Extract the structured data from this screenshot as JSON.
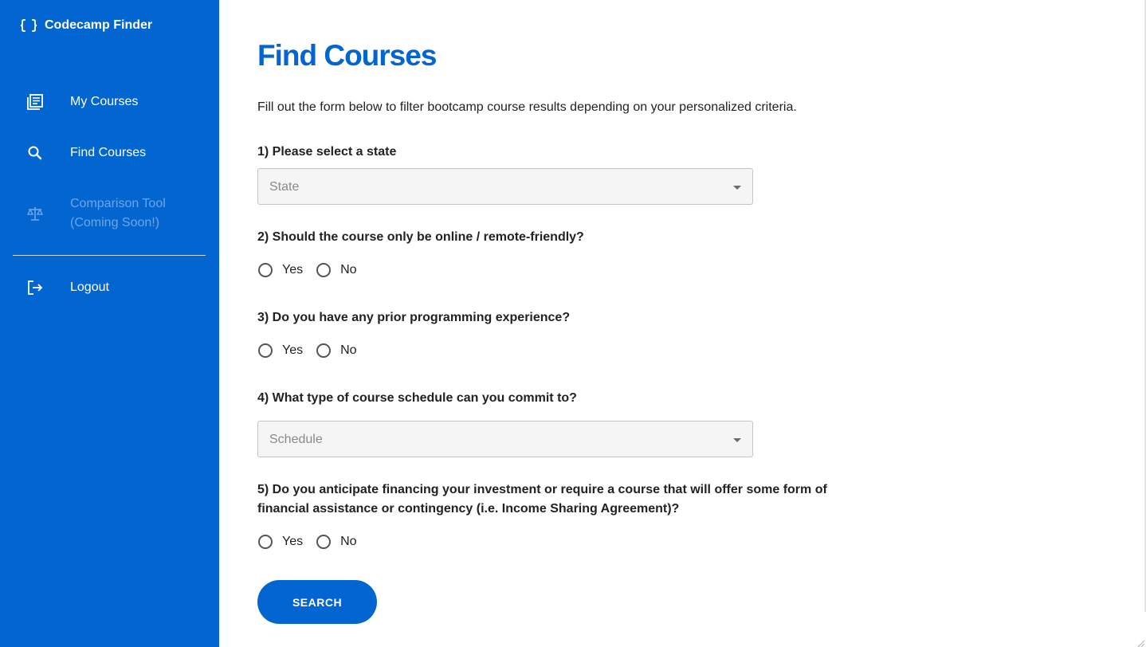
{
  "brand": {
    "name": "Codecamp Finder",
    "icon": "braces-icon"
  },
  "sidebar": {
    "items": [
      {
        "label": "My Courses",
        "icon": "newspaper-icon",
        "enabled": true
      },
      {
        "label": "Find Courses",
        "icon": "search-icon",
        "enabled": true
      },
      {
        "label": "Comparison Tool (Coming Soon!)",
        "icon": "scale-icon",
        "enabled": false
      }
    ],
    "logout": {
      "label": "Logout",
      "icon": "logout-icon"
    }
  },
  "main": {
    "title": "Find Courses",
    "intro": "Fill out the form below to filter bootcamp course results depending on your personalized criteria.",
    "questions": {
      "q1": {
        "label": "1) Please select a state",
        "placeholder": "State"
      },
      "q2": {
        "label": "2) Should the course only be online / remote-friendly?",
        "options": [
          "Yes",
          "No"
        ]
      },
      "q3": {
        "label": "3) Do you have any prior programming experience?",
        "options": [
          "Yes",
          "No"
        ]
      },
      "q4": {
        "label": "4) What type of course schedule can you commit to?",
        "placeholder": "Schedule"
      },
      "q5": {
        "label": "5) Do you anticipate financing your investment or require a course that will offer some form of financial assistance or contingency (i.e. Income Sharing Agreement)?",
        "options": [
          "Yes",
          "No"
        ]
      }
    },
    "search_label": "SEARCH"
  },
  "colors": {
    "primary": "#0365d0",
    "sidebar_disabled": "#6da6e8",
    "text": "#222222"
  }
}
